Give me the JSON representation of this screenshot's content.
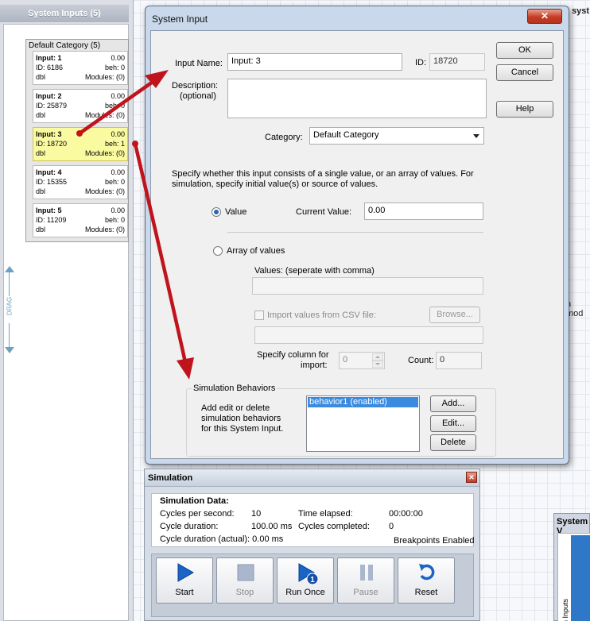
{
  "left_panel": {
    "header": "System Inputs (5)",
    "category_title": "Default Category (5)",
    "drag_label": "DRAG",
    "inputs": [
      {
        "name": "Input: 1",
        "value": "0.00",
        "id": "ID: 6186",
        "beh": "beh: 0",
        "type": "dbl",
        "modules": "Modules: (0)"
      },
      {
        "name": "Input: 2",
        "value": "0.00",
        "id": "ID: 25879",
        "beh": "beh: 0",
        "type": "dbl",
        "modules": "Modules: (0)"
      },
      {
        "name": "Input: 3",
        "value": "0.00",
        "id": "ID: 18720",
        "beh": "beh: 1",
        "type": "dbl",
        "modules": "Modules: (0)"
      },
      {
        "name": "Input: 4",
        "value": "0.00",
        "id": "ID: 15355",
        "beh": "beh: 0",
        "type": "dbl",
        "modules": "Modules: (0)"
      },
      {
        "name": "Input: 5",
        "value": "0.00",
        "id": "ID: 11209",
        "beh": "beh: 0",
        "type": "dbl",
        "modules": "Modules: (0)"
      }
    ]
  },
  "background": {
    "top_right_text": "syst",
    "mid_right_text": "n mod"
  },
  "dialog": {
    "title": "System Input",
    "close_glyph": "✕",
    "input_name_label": "Input Name:",
    "input_name_value": "Input: 3",
    "id_label": "ID:",
    "id_value": "18720",
    "description_label_1": "Description:",
    "description_label_2": "(optional)",
    "description_value": "",
    "category_label": "Category:",
    "category_value": "Default Category",
    "ok_label": "OK",
    "cancel_label": "Cancel",
    "help_label": "Help",
    "instructions_1": "Specify whether this input consists of a single value, or an array of values. For",
    "instructions_2": "simulation, specify initial value(s) or source of values.",
    "value_radio_label": "Value",
    "current_value_label": "Current Value:",
    "current_value": "0.00",
    "array_radio_label": "Array of values",
    "values_label": "Values: (seperate with comma)",
    "values_value": "",
    "import_csv_label": "Import values from CSV file:",
    "browse_label": "Browse...",
    "csv_path_value": "",
    "specify_column_label_1": "Specify column for",
    "specify_column_label_2": "import:",
    "column_value": "0",
    "count_label": "Count:",
    "count_value": "0",
    "sim_behaviors_legend": "Simulation Behaviors",
    "sim_behaviors_desc_1": "Add edit or delete",
    "sim_behaviors_desc_2": "simulation behaviors",
    "sim_behaviors_desc_3": "for this System Input.",
    "behaviors": [
      "behavior1 (enabled)"
    ],
    "add_label": "Add...",
    "edit_label": "Edit...",
    "delete_label": "Delete"
  },
  "simulation": {
    "title": "Simulation",
    "close_glyph": "✕",
    "data_title": "Simulation Data:",
    "cps_label": "Cycles per second:",
    "cps_value": "10",
    "time_elapsed_label": "Time elapsed:",
    "time_elapsed_value": "00:00:00",
    "cycle_duration_label": "Cycle duration:",
    "cycle_duration_value": "100.00 ms",
    "cycles_completed_label": "Cycles completed:",
    "cycles_completed_value": "0",
    "cycle_duration_actual_label": "Cycle duration (actual): 0.00 ms",
    "breakpoints_label": "Breakpoints Enabled",
    "buttons": {
      "start": "Start",
      "stop": "Stop",
      "run_once": "Run Once",
      "pause": "Pause",
      "reset": "Reset"
    }
  },
  "system_view": {
    "title": "System V",
    "vertical_label": "n Inputs"
  },
  "colors": {
    "selected_card": "#fafaa0",
    "arrow": "#c0141c",
    "list_selection": "#3a8ae0"
  }
}
